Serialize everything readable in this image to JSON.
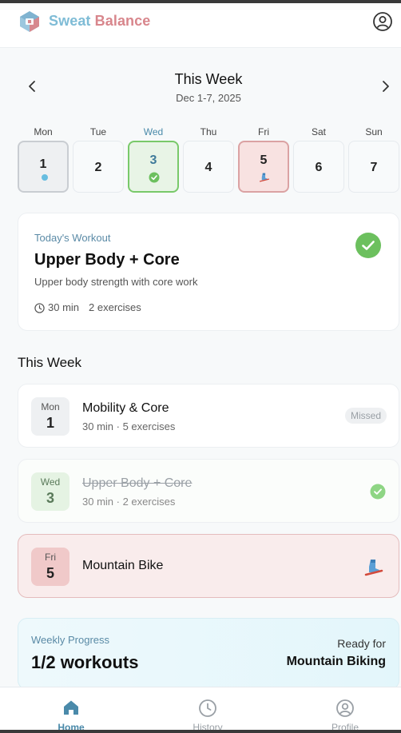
{
  "app": {
    "name_part1": "Sweat",
    "name_part2": " Balance"
  },
  "week": {
    "title": "This Week",
    "range": "Dec 1-7, 2025"
  },
  "days": [
    {
      "label": "Mon",
      "num": "1",
      "state": "today"
    },
    {
      "label": "Tue",
      "num": "2",
      "state": "none"
    },
    {
      "label": "Wed",
      "num": "3",
      "state": "done"
    },
    {
      "label": "Thu",
      "num": "4",
      "state": "none"
    },
    {
      "label": "Fri",
      "num": "5",
      "state": "planned"
    },
    {
      "label": "Sat",
      "num": "6",
      "state": "none"
    },
    {
      "label": "Sun",
      "num": "7",
      "state": "none"
    }
  ],
  "today": {
    "label": "Today's Workout",
    "title": "Upper Body + Core",
    "description": "Upper body strength with core work",
    "duration": "30 min",
    "exercises": "2 exercises"
  },
  "section_title": "This Week",
  "sessions": [
    {
      "day": "Mon",
      "num": "1",
      "title": "Mobility & Core",
      "sub": "30 min · 5 exercises",
      "status": "Missed"
    },
    {
      "day": "Wed",
      "num": "3",
      "title": "Upper Body + Core",
      "sub": "30 min · 2 exercises",
      "status": "completed"
    },
    {
      "day": "Fri",
      "num": "5",
      "title": "Mountain Bike",
      "sub": "",
      "status": "planned"
    }
  ],
  "progress": {
    "label": "Weekly Progress",
    "value": "1/2 workouts",
    "ready_label": "Ready for",
    "ready_target": "Mountain Biking"
  },
  "nav": [
    {
      "label": "Home",
      "icon": "home-icon",
      "active": true
    },
    {
      "label": "History",
      "icon": "history-icon",
      "active": false
    },
    {
      "label": "Profile",
      "icon": "profile-icon",
      "active": false
    }
  ],
  "colors": {
    "accent": "#4a8aaa",
    "success": "#6cc05e",
    "planned": "#dba2a3",
    "brand_blue": "#7fbcd6",
    "brand_pink": "#d8868c"
  }
}
